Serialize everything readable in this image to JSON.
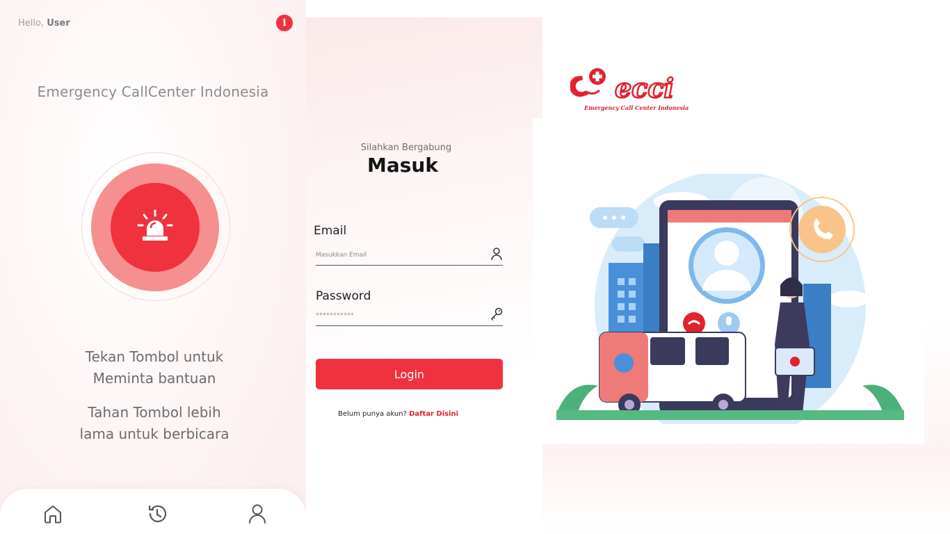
{
  "mobile": {
    "greeting_prefix": "Hello,",
    "greeting_name": "User",
    "info_icon": "info-icon",
    "app_title": "Emergency CallCenter Indonesia",
    "sos_icon": "siren-icon",
    "help_line1": "Tekan Tombol untuk",
    "help_line2": "Meminta bantuan",
    "help_line3": "Tahan Tombol lebih",
    "help_line4": "lama untuk berbicara",
    "nav": [
      {
        "icon": "home-icon"
      },
      {
        "icon": "history-icon"
      },
      {
        "icon": "profile-icon"
      }
    ]
  },
  "login": {
    "subtitle": "Silahkan Bergabung",
    "title": "Masuk",
    "email_label": "Email",
    "email_placeholder": "Masukkan Email",
    "password_label": "Password",
    "password_placeholder": "***********",
    "login_button": "Login",
    "register_prompt": "Belum punya akun?",
    "register_link": "Daftar Disini"
  },
  "brand": {
    "logo_text": "ecci",
    "logo_tagline": "Emergency Call Center Indonesia"
  },
  "colors": {
    "accent": "#f0323f",
    "accent_light": "#f68f8f",
    "illustration_blue": "#4a90d9"
  }
}
